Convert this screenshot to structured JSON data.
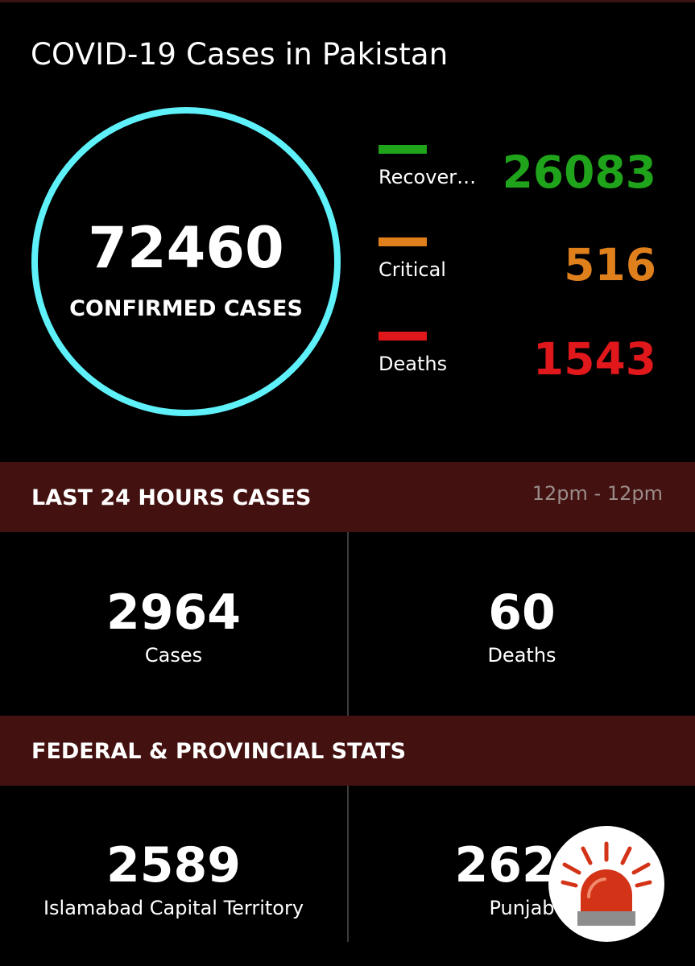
{
  "title": "COVID-19 Cases in Pakistan",
  "confirmed": {
    "value": "72460",
    "label": "CONFIRMED CASES"
  },
  "stats": [
    {
      "label": "Recover…",
      "value": "26083",
      "color": "#1fa31a"
    },
    {
      "label": "Critical",
      "value": "516",
      "color": "#e0801d"
    },
    {
      "label": "Deaths",
      "value": "1543",
      "color": "#e0171b"
    }
  ],
  "last24": {
    "title": "LAST 24 HOURS CASES",
    "time_range": "12pm - 12pm",
    "cases": {
      "value": "2964",
      "label": "Cases"
    },
    "deaths": {
      "value": "60",
      "label": "Deaths"
    }
  },
  "federal": {
    "title": "FEDERAL & PROVINCIAL STATS",
    "regions": [
      {
        "value": "2589",
        "label": "Islamabad Capital Territory"
      },
      {
        "value": "2624",
        "label": "Punjab"
      }
    ]
  },
  "colors": {
    "ring": "#5ef1f9",
    "section_background": "#43110f",
    "alert_red": "#d33317"
  },
  "alert_button": {
    "icon": "siren-icon"
  }
}
